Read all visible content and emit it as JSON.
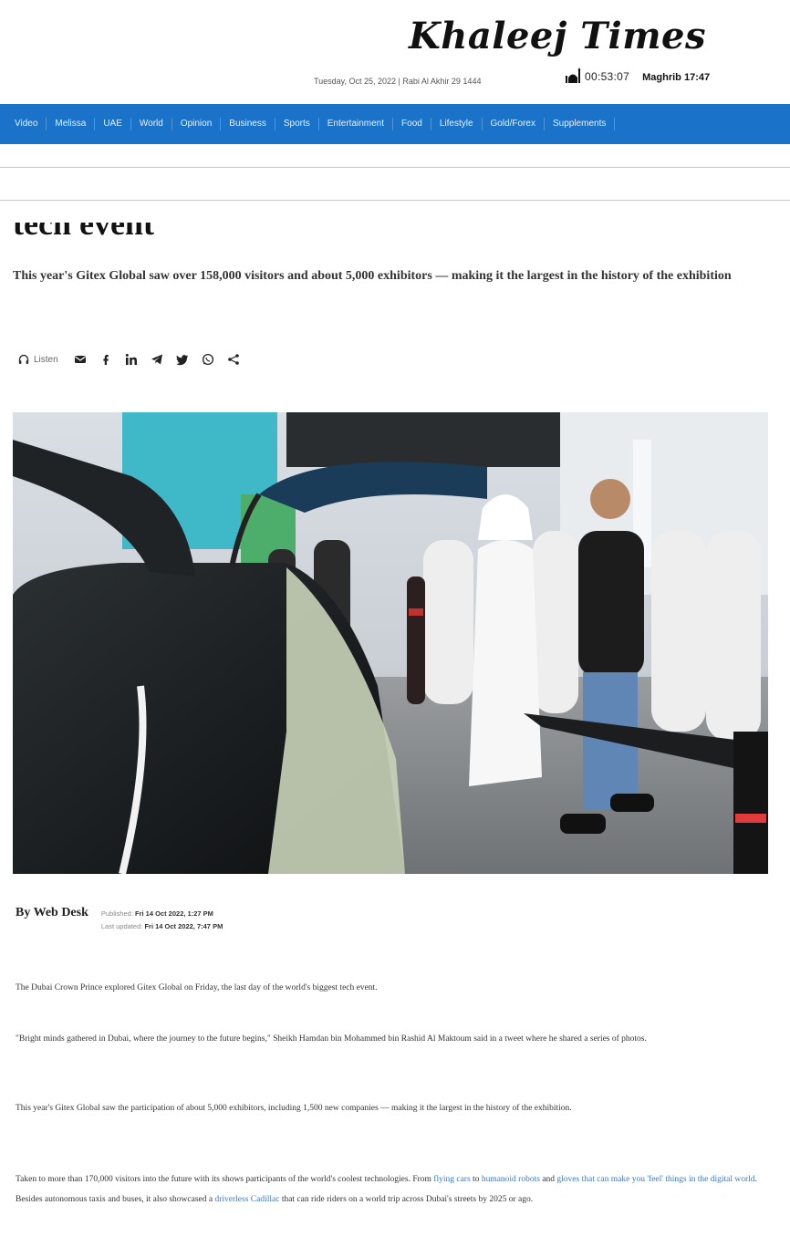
{
  "masthead": {
    "logo": "Khaleej Times",
    "dateline": "Tuesday, Oct 25, 2022 | Rabi Al Akhir 29 1444",
    "prayer_countdown": "00:53:07",
    "next_prayer": "Maghrib 17:47"
  },
  "nav": {
    "items": [
      "Video",
      "Melissa",
      "UAE",
      "World",
      "Opinion",
      "Business",
      "Sports",
      "Entertainment",
      "Food",
      "Lifestyle",
      "Gold/Forex",
      "Supplements"
    ]
  },
  "article": {
    "headline_tail": "tech event",
    "dek": "This year's Gitex Global saw over 158,000 visitors and about 5,000 exhibitors — making it the largest in the history of the exhibition",
    "listen_label": "Listen",
    "byline": {
      "author": "By Web Desk",
      "published_label": "Published:",
      "published": "Fri 14 Oct 2022, 1:27 PM",
      "updated_label": "Last updated:",
      "updated": "Fri 14 Oct 2022, 7:47 PM"
    },
    "paragraphs": {
      "p1": "The Dubai Crown Prince explored Gitex Global on Friday, the last day of the world's biggest tech event.",
      "p2": "\"Bright minds gathered in Dubai, where the journey to the future begins,\" Sheikh Hamdan bin Mohammed bin Rashid Al Maktoum said in a tweet where he shared a series of photos.",
      "p3": "This year's Gitex Global saw the participation of about 5,000 exhibitors, including 1,500 new companies — making it the largest in the history of the exhibition.",
      "p4_a": "Taken to more than 170,000 visitors into the future with its shows participants of the world's coolest technologies. From ",
      "p4_link1": "flying cars",
      "p4_b": " to ",
      "p4_link2": "humanoid robots",
      "p4_c": " and ",
      "p4_link3": "gloves that can make you 'feel' things in the digital world",
      "p4_d": ". Besides autonomous taxis and buses, it also showcased a ",
      "p4_link4": "driverless Cadillac",
      "p4_e": " that can ride riders on a world trip across Dubai's streets by 2025 or ago."
    }
  },
  "colors": {
    "nav_bg": "#1a73c8",
    "link": "#3a78c3"
  },
  "icons": [
    "headphones-icon",
    "email-icon",
    "facebook-icon",
    "linkedin-icon",
    "telegram-icon",
    "twitter-icon",
    "whatsapp-icon",
    "share-icon"
  ]
}
